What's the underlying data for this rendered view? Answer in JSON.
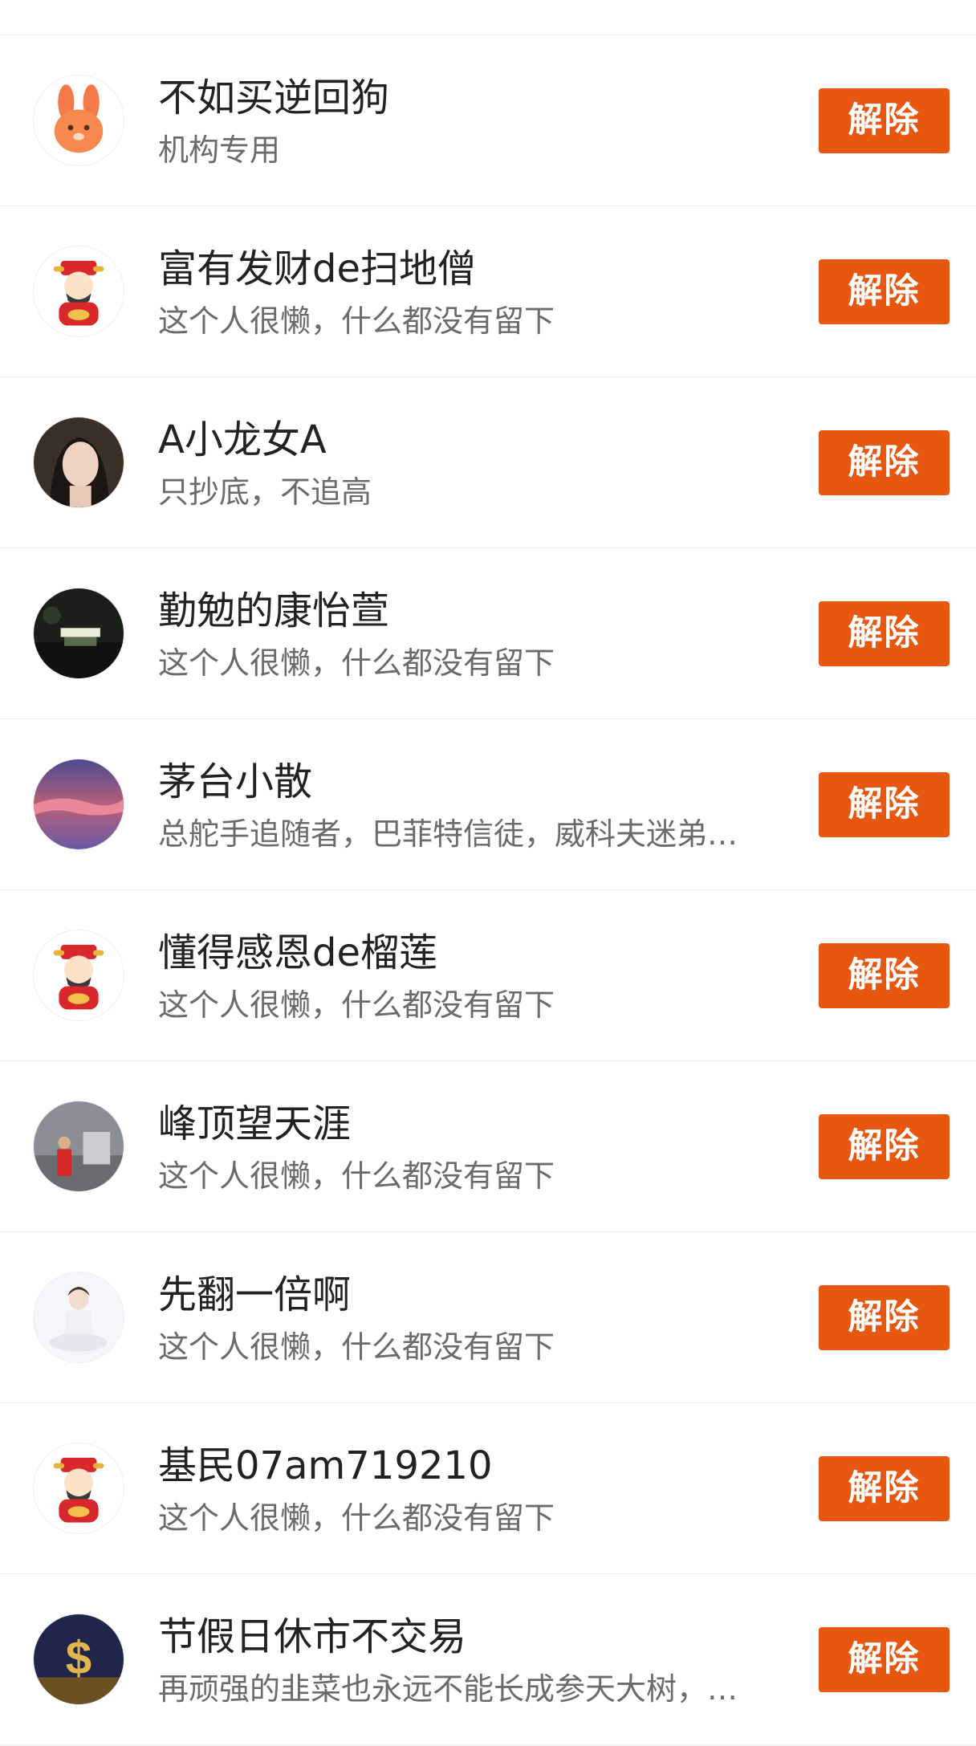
{
  "colors": {
    "accent": "#e8570f",
    "name_text": "#222222",
    "bio_text": "#6b6b6b",
    "divider": "#ececec"
  },
  "users": [
    {
      "name": "不如买逆回狗",
      "bio": "机构专用",
      "avatar_icon": "rabbit-avatar-icon",
      "button": "解除"
    },
    {
      "name": "富有发财de扫地僧",
      "bio": "这个人很懒，什么都没有留下",
      "avatar_icon": "fortune-god-avatar-icon",
      "button": "解除"
    },
    {
      "name": "A小龙女A",
      "bio": "只抄底，不追高",
      "avatar_icon": "portrait-photo-avatar-icon",
      "button": "解除"
    },
    {
      "name": "勤勉的康怡萱",
      "bio": "这个人很懒，什么都没有留下",
      "avatar_icon": "night-scene-avatar-icon",
      "button": "解除"
    },
    {
      "name": "茅台小散",
      "bio": "总舵手追随者，巴菲特信徒，威科夫迷弟…",
      "avatar_icon": "sunset-sky-avatar-icon",
      "button": "解除"
    },
    {
      "name": "懂得感恩de榴莲",
      "bio": "这个人很懒，什么都没有留下",
      "avatar_icon": "fortune-god-avatar-icon",
      "button": "解除"
    },
    {
      "name": "峰顶望天涯",
      "bio": "这个人很懒，什么都没有留下",
      "avatar_icon": "outdoor-person-avatar-icon",
      "button": "解除"
    },
    {
      "name": "先翻一倍啊",
      "bio": "这个人很懒，什么都没有留下",
      "avatar_icon": "meditating-girl-avatar-icon",
      "button": "解除"
    },
    {
      "name": "基民07am719210",
      "bio": "这个人很懒，什么都没有留下",
      "avatar_icon": "fortune-god-avatar-icon",
      "button": "解除"
    },
    {
      "name": "节假日休市不交易",
      "bio": "再顽强的韭菜也永远不能长成参天大树，…",
      "avatar_icon": "gold-dollar-avatar-icon",
      "button": "解除"
    }
  ]
}
